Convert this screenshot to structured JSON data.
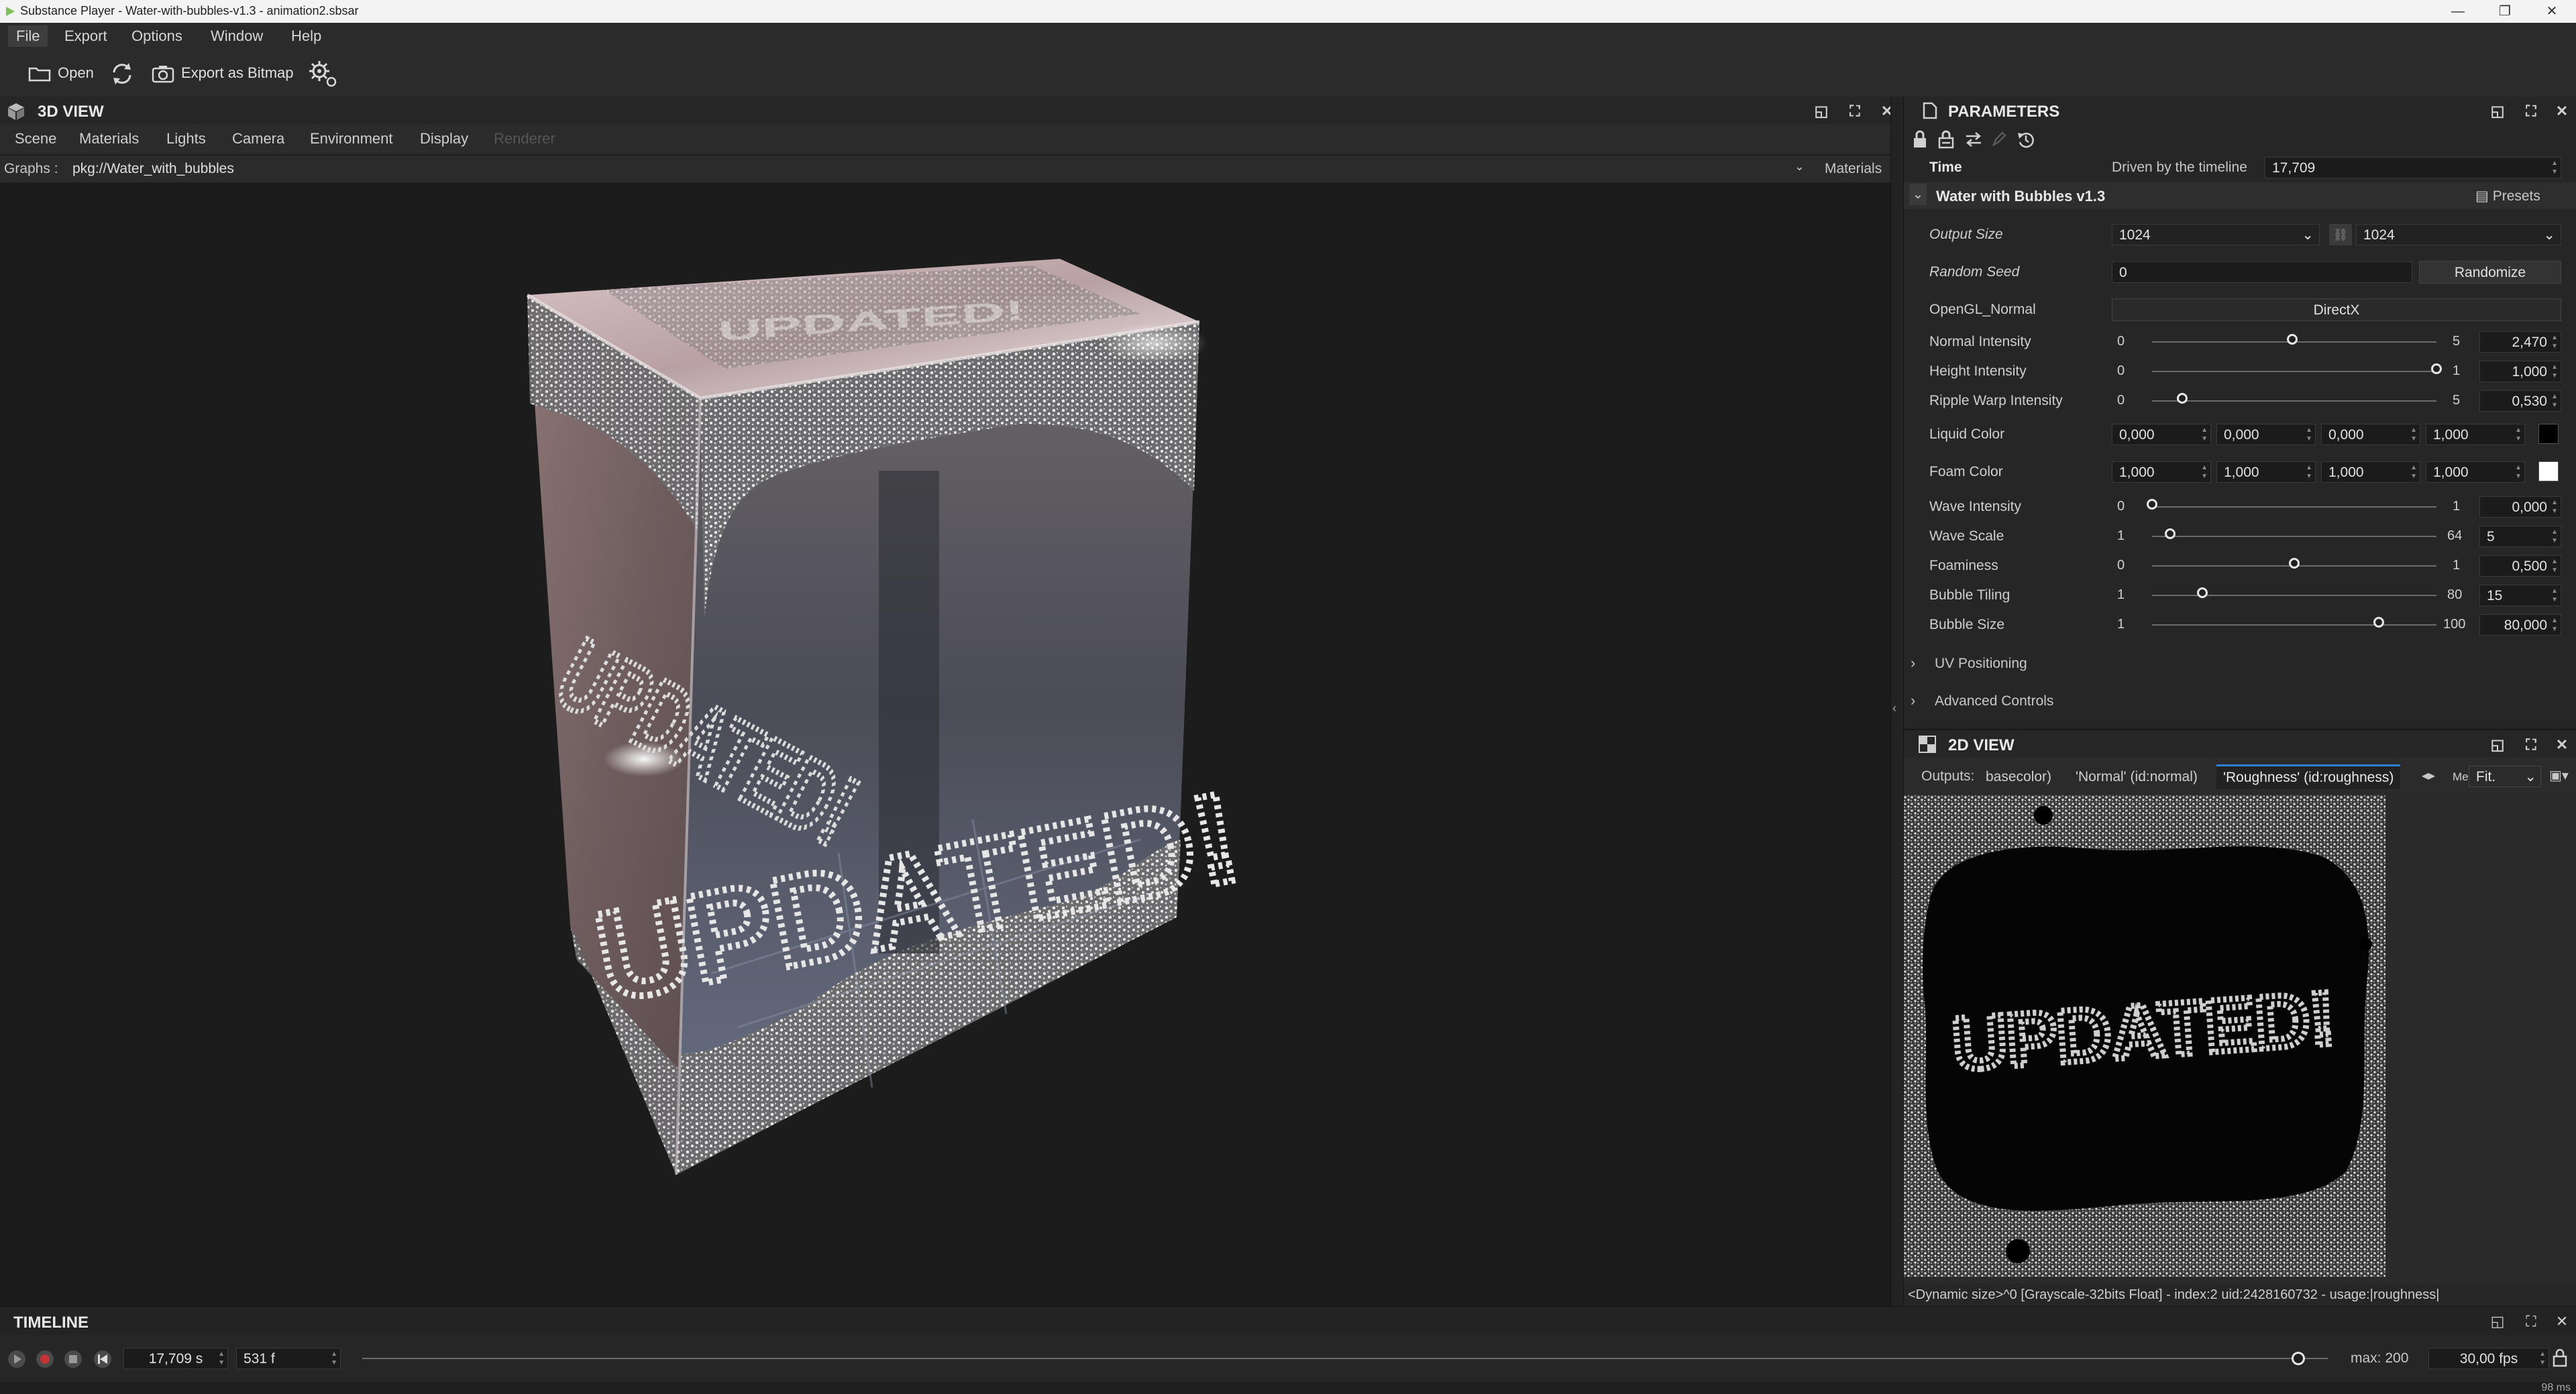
{
  "window": {
    "title": "Substance Player - Water-with-bubbles-v1.3 - animation2.sbsar"
  },
  "menu": [
    "File",
    "Export",
    "Options",
    "Window",
    "Help"
  ],
  "toolbar": {
    "open_label": "Open",
    "export_label": "Export as Bitmap"
  },
  "view3d": {
    "title": "3D VIEW",
    "tabs": [
      "Scene",
      "Materials",
      "Lights",
      "Camera",
      "Environment",
      "Display",
      "Renderer"
    ],
    "graphs_label": "Graphs :",
    "graph_value": "pkg://Water_with_bubbles",
    "materials_label": "Materials",
    "cube_text": "UPDATED!"
  },
  "parameters": {
    "title": "PARAMETERS",
    "time_label": "Time",
    "time_driver": "Driven by the timeline",
    "time_value": "17,709",
    "group_title": "Water with Bubbles v1.3",
    "presets_label": "Presets",
    "output_size_label": "Output Size",
    "output_size_w": "1024",
    "output_size_h": "1024",
    "random_seed_label": "Random Seed",
    "random_seed_value": "0",
    "randomize_label": "Randomize",
    "normal_label": "OpenGL_Normal",
    "normal_value": "DirectX",
    "sliders": [
      {
        "label": "Normal Intensity",
        "min": "0",
        "max": "5",
        "value": "2,470",
        "frac": 0.494
      },
      {
        "label": "Height Intensity",
        "min": "0",
        "max": "1",
        "value": "1,000",
        "frac": 1.0
      },
      {
        "label": "Ripple Warp Intensity",
        "min": "0",
        "max": "5",
        "value": "0,530",
        "frac": 0.106
      }
    ],
    "liquid_color": {
      "label": "Liquid Color",
      "values": [
        "0,000",
        "0,000",
        "0,000",
        "1,000"
      ],
      "swatch": "#000000"
    },
    "foam_color": {
      "label": "Foam Color",
      "values": [
        "1,000",
        "1,000",
        "1,000",
        "1,000"
      ],
      "swatch": "#ffffff"
    },
    "sliders2": [
      {
        "label": "Wave Intensity",
        "min": "0",
        "max": "1",
        "value": "0,000",
        "frac": 0.0
      },
      {
        "label": "Wave Scale",
        "min": "1",
        "max": "64",
        "value": "5",
        "frac": 0.063
      },
      {
        "label": "Foaminess",
        "min": "0",
        "max": "1",
        "value": "0,500",
        "frac": 0.5
      },
      {
        "label": "Bubble Tiling",
        "min": "1",
        "max": "80",
        "value": "15",
        "frac": 0.177
      },
      {
        "label": "Bubble Size",
        "min": "1",
        "max": "100",
        "value": "80,000",
        "frac": 0.798
      }
    ],
    "sections": [
      "UV Positioning",
      "Advanced Controls"
    ]
  },
  "view2d": {
    "title": "2D VIEW",
    "outputs_label": "Outputs:",
    "tabs": [
      "basecolor)",
      "'Normal' (id:normal)",
      "'Roughness' (id:roughness)",
      "Meta"
    ],
    "fit_label": "Fit.",
    "texture_text": "UPDATED!",
    "status": "<Dynamic size>^0 [Grayscale-32bits Float] - index:2 uid:2428160732 - usage:|roughness|"
  },
  "timeline": {
    "title": "TIMELINE",
    "time_value": "17,709 s",
    "frame_value": "531 f",
    "frac": 0.985,
    "max_label": "max: 200",
    "fps_value": "30,00 fps"
  },
  "status_ms": "98 ms",
  "colors": {
    "accent": "#2f7fd6",
    "panel": "#262626",
    "viewport": "#1c1c1c"
  }
}
